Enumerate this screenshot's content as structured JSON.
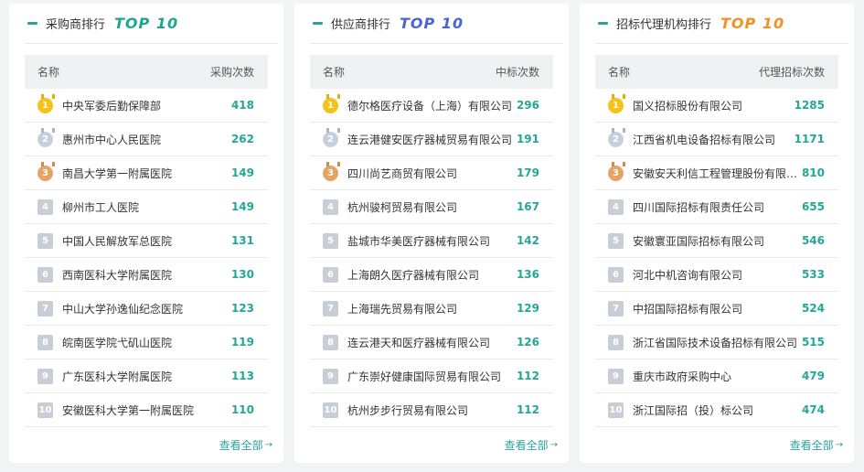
{
  "panels": [
    {
      "title": "采购商排行",
      "badge": "TOP 10",
      "badge_color": "#1aa68f",
      "col_name": "名称",
      "col_value": "采购次数",
      "more": "查看全部",
      "rows": [
        {
          "rank": "1",
          "name": "中央军委后勤保障部",
          "value": "418"
        },
        {
          "rank": "2",
          "name": "惠州市中心人民医院",
          "value": "262"
        },
        {
          "rank": "3",
          "name": "南昌大学第一附属医院",
          "value": "149"
        },
        {
          "rank": "4",
          "name": "柳州市工人医院",
          "value": "149"
        },
        {
          "rank": "5",
          "name": "中国人民解放军总医院",
          "value": "131"
        },
        {
          "rank": "6",
          "name": "西南医科大学附属医院",
          "value": "130"
        },
        {
          "rank": "7",
          "name": "中山大学孙逸仙纪念医院",
          "value": "123"
        },
        {
          "rank": "8",
          "name": "皖南医学院弋矶山医院",
          "value": "119"
        },
        {
          "rank": "9",
          "name": "广东医科大学附属医院",
          "value": "113"
        },
        {
          "rank": "10",
          "name": "安徽医科大学第一附属医院",
          "value": "110"
        }
      ]
    },
    {
      "title": "供应商排行",
      "badge": "TOP 10",
      "badge_color": "#4a64d8",
      "col_name": "名称",
      "col_value": "中标次数",
      "more": "查看全部",
      "rows": [
        {
          "rank": "1",
          "name": "德尔格医疗设备（上海）有限公司",
          "value": "296"
        },
        {
          "rank": "2",
          "name": "连云港健安医疗器械贸易有限公司",
          "value": "191"
        },
        {
          "rank": "3",
          "name": "四川尚艺商贸有限公司",
          "value": "179"
        },
        {
          "rank": "4",
          "name": "杭州骏柯贸易有限公司",
          "value": "167"
        },
        {
          "rank": "5",
          "name": "盐城市华美医疗器械有限公司",
          "value": "142"
        },
        {
          "rank": "6",
          "name": "上海朗久医疗器械有限公司",
          "value": "136"
        },
        {
          "rank": "7",
          "name": "上海瑞先贸易有限公司",
          "value": "129"
        },
        {
          "rank": "8",
          "name": "连云港天和医疗器械有限公司",
          "value": "126"
        },
        {
          "rank": "9",
          "name": "广东崇好健康国际贸易有限公司",
          "value": "112"
        },
        {
          "rank": "10",
          "name": "杭州步步行贸易有限公司",
          "value": "112"
        }
      ]
    },
    {
      "title": "招标代理机构排行",
      "badge": "TOP 10",
      "badge_color": "#f29121",
      "col_name": "名称",
      "col_value": "代理招标次数",
      "more": "查看全部",
      "rows": [
        {
          "rank": "1",
          "name": "国义招标股份有限公司",
          "value": "1285"
        },
        {
          "rank": "2",
          "name": "江西省机电设备招标有限公司",
          "value": "1171"
        },
        {
          "rank": "3",
          "name": "安徽安天利信工程管理股份有限公司",
          "value": "810"
        },
        {
          "rank": "4",
          "name": "四川国际招标有限责任公司",
          "value": "655"
        },
        {
          "rank": "5",
          "name": "安徽寰亚国际招标有限公司",
          "value": "546"
        },
        {
          "rank": "6",
          "name": "河北中机咨询有限公司",
          "value": "533"
        },
        {
          "rank": "7",
          "name": "中招国际招标有限公司",
          "value": "524"
        },
        {
          "rank": "8",
          "name": "浙江省国际技术设备招标有限公司",
          "value": "515"
        },
        {
          "rank": "9",
          "name": "重庆市政府采购中心",
          "value": "479"
        },
        {
          "rank": "10",
          "name": "浙江国际招（投）标公司",
          "value": "474"
        }
      ]
    }
  ],
  "colors": {
    "value_green": "#24a794",
    "accent": "#2aa59b",
    "gold": "#f6c21a",
    "silver": "#c6d0dd",
    "bronze": "#e5a463",
    "rank_gray": "#c8ced6"
  }
}
